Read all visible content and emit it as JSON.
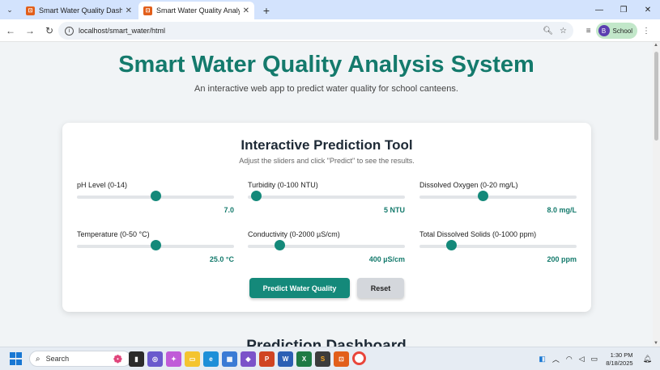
{
  "browser": {
    "tabs": [
      {
        "title": "Smart Water Quality Dashboard",
        "active": false
      },
      {
        "title": "Smart Water Quality Analysis Sy",
        "active": true
      }
    ],
    "url": "localhost/smart_water/html",
    "profile_initial": "B",
    "profile_label": "School"
  },
  "page": {
    "title": "Smart Water Quality Analysis System",
    "subtitle": "An interactive web app to predict water quality for school canteens."
  },
  "tool": {
    "title": "Interactive Prediction Tool",
    "subtitle": "Adjust the sliders and click \"Predict\" to see the results.",
    "sliders": [
      {
        "label": "pH Level (0-14)",
        "value": 7.0,
        "min": 0,
        "max": 14,
        "display": "7.0"
      },
      {
        "label": "Turbidity (0-100 NTU)",
        "value": 5,
        "min": 0,
        "max": 100,
        "display": "5 NTU"
      },
      {
        "label": "Dissolved Oxygen (0-20 mg/L)",
        "value": 8.0,
        "min": 0,
        "max": 20,
        "display": "8.0 mg/L"
      },
      {
        "label": "Temperature (0-50 °C)",
        "value": 25.0,
        "min": 0,
        "max": 50,
        "display": "25.0 °C"
      },
      {
        "label": "Conductivity (0-2000 µS/cm)",
        "value": 400,
        "min": 0,
        "max": 2000,
        "display": "400 µS/cm"
      },
      {
        "label": "Total Dissolved Solids (0-1000 ppm)",
        "value": 200,
        "min": 0,
        "max": 1000,
        "display": "200 ppm"
      }
    ],
    "predict_label": "Predict Water Quality",
    "reset_label": "Reset"
  },
  "dashboard": {
    "title": "Prediction Dashboard"
  },
  "taskbar": {
    "search_placeholder": "Search",
    "time": "1:30 PM",
    "date": "8/18/2025"
  },
  "colors": {
    "accent": "#147a6c",
    "knob": "#14897a",
    "tabstrip": "#d3e3fd"
  }
}
